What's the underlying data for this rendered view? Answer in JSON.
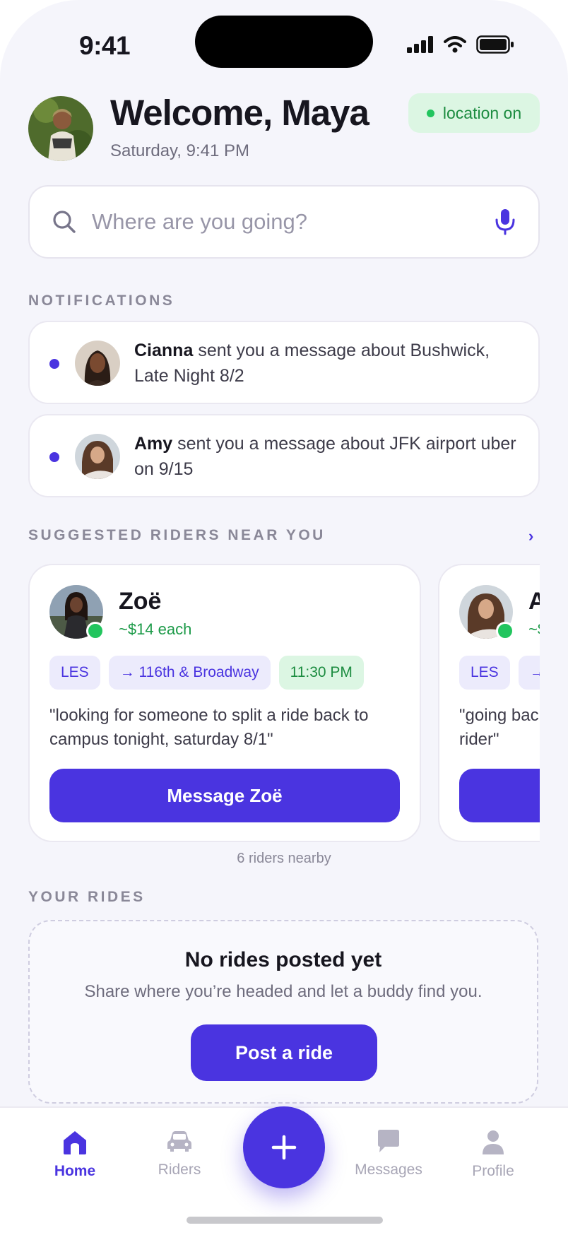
{
  "status_bar": {
    "time": "9:41"
  },
  "header": {
    "welcome": "Welcome, Maya",
    "date": "Saturday, 9:41 PM",
    "location_status": "location on"
  },
  "search": {
    "placeholder": "Where are you going?"
  },
  "notifications": {
    "label": "NOTIFICATIONS",
    "items": [
      {
        "name": "Cianna",
        "text": "sent you a message about Bushwick, Late Night 8/2"
      },
      {
        "name": "Amy",
        "text": "sent you a message about JFK airport uber on 9/15"
      }
    ]
  },
  "suggested": {
    "label": "SUGGESTED RIDERS NEAR YOU",
    "see_all": "›",
    "riders": [
      {
        "name": "Zoë",
        "price": "~$14 each",
        "tags": [
          "LES",
          "→ 116th & Broadway"
        ],
        "time": "11:30 PM",
        "quote": "\"looking for someone to split a ride back to campus tonight, saturday 8/1\"",
        "button": "Message Zoë"
      },
      {
        "name": "A",
        "price": "~$",
        "tags": [
          "LES",
          "→"
        ],
        "time": "",
        "quote": "\"going bac rider\"",
        "button": ""
      }
    ],
    "nearby_count": "6 riders nearby"
  },
  "your_rides": {
    "label": "YOUR RIDES",
    "empty_title": "No rides posted yet",
    "empty_sub": "Share where you’re headed and let a buddy find you.",
    "post_button": "Post a ride"
  },
  "tabbar": {
    "items": [
      {
        "label": "Home",
        "icon": "home-icon",
        "active": true
      },
      {
        "label": "Riders",
        "icon": "car-icon",
        "active": false
      },
      {
        "label": "Messages",
        "icon": "chat-bubble-icon",
        "active": false
      },
      {
        "label": "Profile",
        "icon": "person-icon",
        "active": false
      }
    ],
    "fab_icon": "plus-icon"
  },
  "colors": {
    "accent": "#4a34e0",
    "online": "#22c55e",
    "background": "#f5f5fb"
  }
}
